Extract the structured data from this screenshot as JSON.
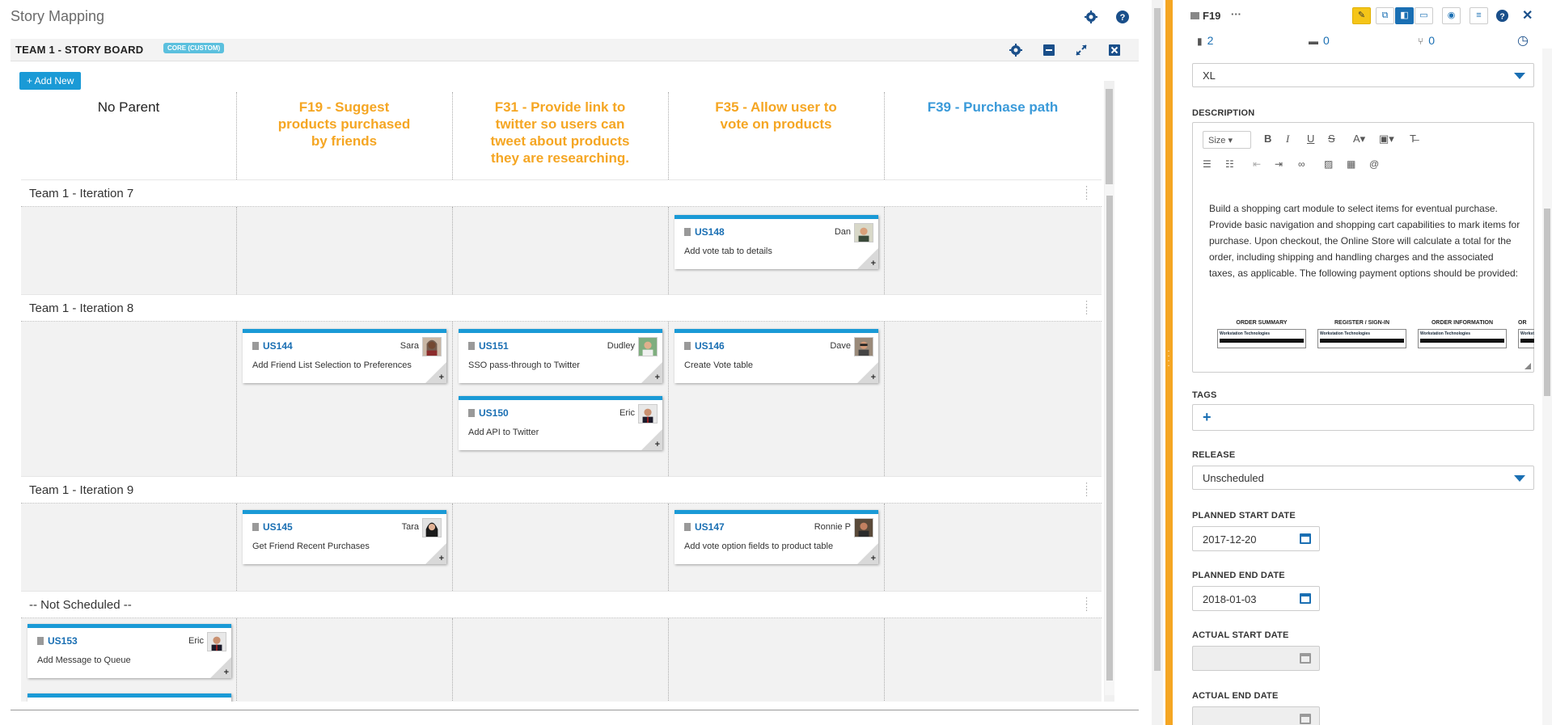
{
  "page": {
    "title": "Story Mapping"
  },
  "board": {
    "title": "TEAM 1 - STORY BOARD",
    "badge": "CORE (CUSTOM)",
    "add_new_label": "+ Add New",
    "columns": [
      {
        "label": "No Parent",
        "id": "",
        "name": ""
      },
      {
        "label": "",
        "id": "F19",
        "name": " - Suggest products purchased by friends"
      },
      {
        "label": "",
        "id": "F31",
        "name": " - Provide link to twitter so users can tweet about products they are researching."
      },
      {
        "label": "",
        "id": "F35",
        "name": " - Allow user to vote on products"
      },
      {
        "label": "",
        "id": "F39",
        "name": " - Purchase path"
      }
    ],
    "rows": [
      {
        "label": "Team 1 - Iteration 7"
      },
      {
        "label": "Team 1 - Iteration 8"
      },
      {
        "label": "Team 1 - Iteration 9"
      },
      {
        "label": "-- Not Scheduled --"
      }
    ],
    "cards": [
      {
        "id": "US148",
        "owner": "Dan",
        "desc": "Add vote tab to details"
      },
      {
        "id": "US144",
        "owner": "Sara",
        "desc": "Add Friend List Selection to Preferences"
      },
      {
        "id": "US151",
        "owner": "Dudley",
        "desc": "SSO pass-through to Twitter"
      },
      {
        "id": "US150",
        "owner": "Eric",
        "desc": "Add API to Twitter"
      },
      {
        "id": "US146",
        "owner": "Dave",
        "desc": "Create Vote table"
      },
      {
        "id": "US145",
        "owner": "Tara",
        "desc": "Get Friend Recent Purchases"
      },
      {
        "id": "US147",
        "owner": "Ronnie P",
        "desc": "Add vote option fields to product table"
      },
      {
        "id": "US153",
        "owner": "Eric",
        "desc": "Add Message to Queue"
      }
    ],
    "card_plus": "+"
  },
  "colors": {
    "feature_orange": "#f5a623",
    "feature_blue": "#3a9ad9",
    "card_accent": "#1a9ad6",
    "panel_accent": "#f5a623"
  },
  "panel": {
    "title": "F19",
    "more": "···",
    "stats": {
      "stories": "2",
      "comments": "0",
      "branches": "0"
    },
    "size_value": "XL",
    "description_label": "DESCRIPTION",
    "editor_size": "Size",
    "description_text": "Build a shopping cart module to select items for eventual purchase. Provide basic navigation and shopping cart capabilities to mark items for purchase. Upon checkout, the Online Store will calculate a total for the order, including shipping and handling charges and the associated taxes, as applicable.  The following payment options should be provided:",
    "image_sections": [
      "ORDER SUMMARY",
      "REGISTER / SIGN-IN",
      "ORDER INFORMATION",
      "OR"
    ],
    "image_brand": "Workstation Technologies",
    "tags_label": "TAGS",
    "tags_add": "+",
    "release_label": "RELEASE",
    "release_value": "Unscheduled",
    "planned_start_label": "PLANNED START DATE",
    "planned_start": "2017-12-20",
    "planned_end_label": "PLANNED END DATE",
    "planned_end": "2018-01-03",
    "actual_start_label": "ACTUAL START DATE",
    "actual_start": "",
    "actual_end_label": "ACTUAL END DATE",
    "actual_end": ""
  }
}
